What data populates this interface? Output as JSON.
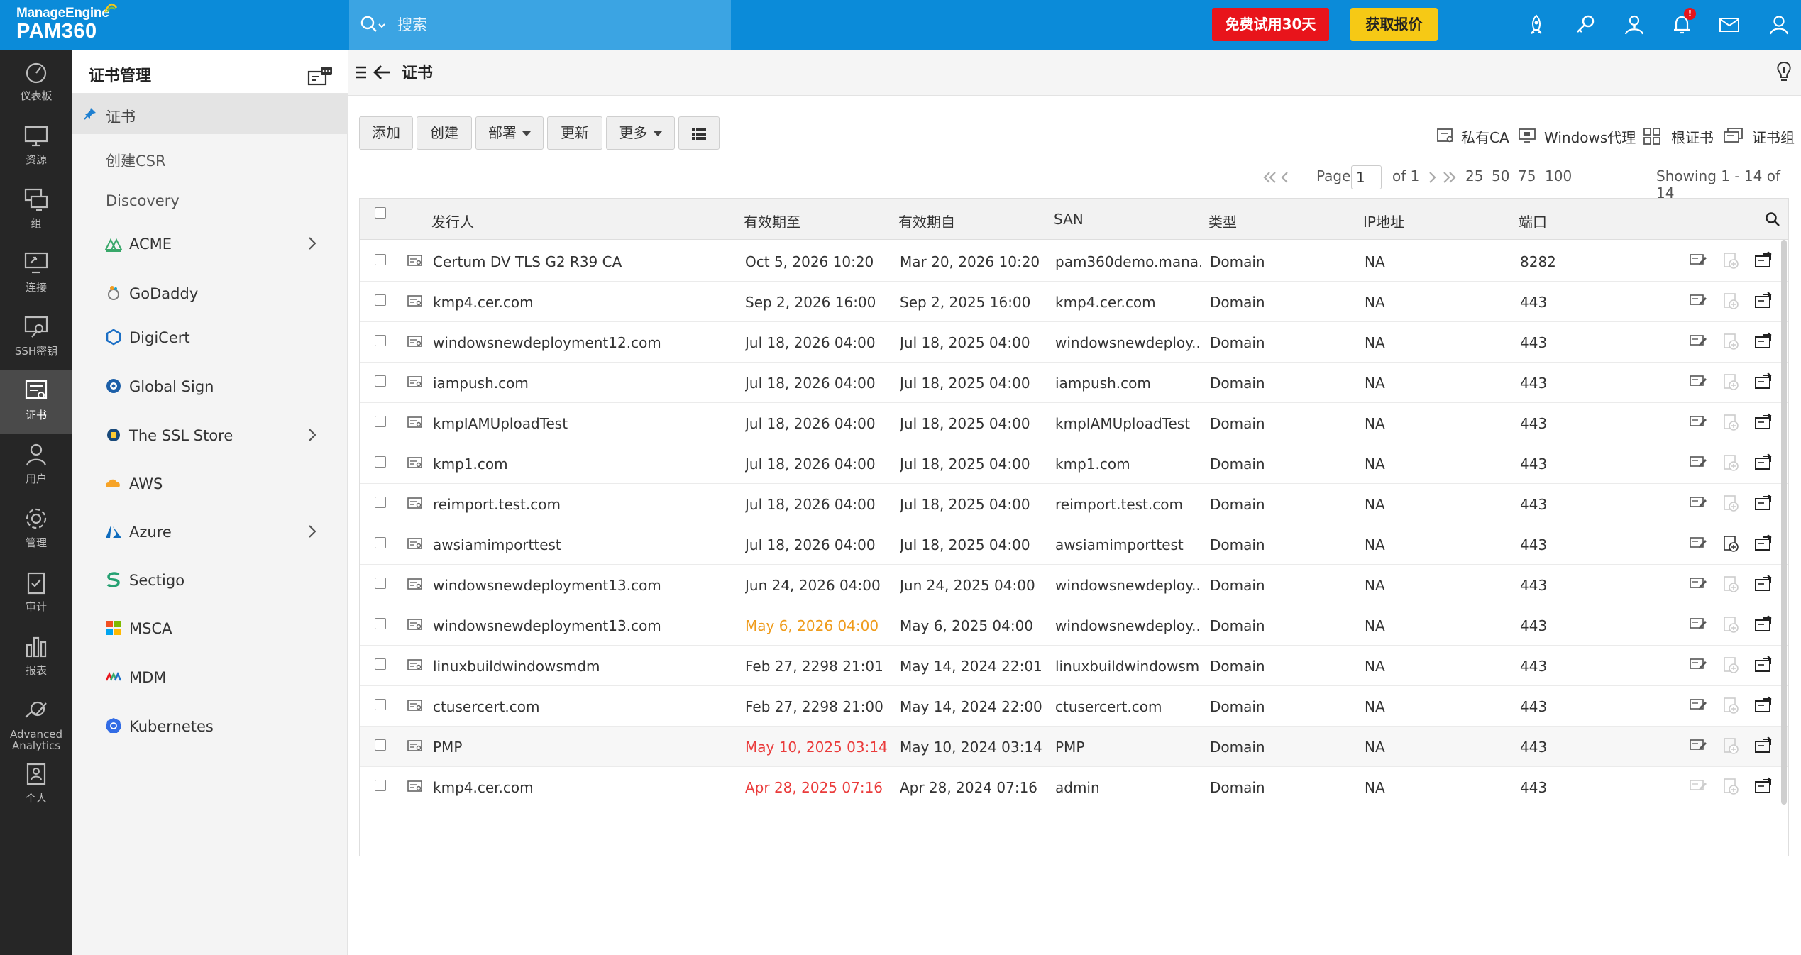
{
  "brand": {
    "vendor": "ManageEngine",
    "product": "PAM360"
  },
  "topbar": {
    "search_placeholder": "搜索",
    "trial_label": "免费试用30天",
    "quote_label": "获取报价",
    "notification_count": "!",
    "icons": [
      "rocket-icon",
      "key-link-icon",
      "user-star-icon",
      "bell-icon",
      "mail-icon",
      "user-icon"
    ]
  },
  "rail": [
    {
      "name": "dashboard",
      "label": "仪表板"
    },
    {
      "name": "resources",
      "label": "资源"
    },
    {
      "name": "groups",
      "label": "组"
    },
    {
      "name": "connections",
      "label": "连接"
    },
    {
      "name": "ssh-keys",
      "label": "SSH密钥"
    },
    {
      "name": "certificates",
      "label": "证书",
      "active": true
    },
    {
      "name": "users",
      "label": "用户"
    },
    {
      "name": "admin",
      "label": "管理"
    },
    {
      "name": "audit",
      "label": "审计"
    },
    {
      "name": "reports",
      "label": "报表"
    },
    {
      "name": "advanced-analytics",
      "label": "Advanced Analytics"
    },
    {
      "name": "personal",
      "label": "个人"
    }
  ],
  "sidenav": {
    "title": "证书管理",
    "items": [
      {
        "label": "证书",
        "active": true
      },
      {
        "label": "创建CSR"
      },
      {
        "label": "Discovery"
      },
      {
        "label": "ACME",
        "has_children": true
      },
      {
        "label": "GoDaddy"
      },
      {
        "label": "DigiCert"
      },
      {
        "label": "Global Sign"
      },
      {
        "label": "The SSL Store",
        "has_children": true
      },
      {
        "label": "AWS"
      },
      {
        "label": "Azure",
        "has_children": true
      },
      {
        "label": "Sectigo"
      },
      {
        "label": "MSCA"
      },
      {
        "label": "MDM"
      },
      {
        "label": "Kubernetes"
      }
    ]
  },
  "page": {
    "title": "证书"
  },
  "toolbar": {
    "add": "添加",
    "create": "创建",
    "deploy": "部署",
    "update": "更新",
    "more": "更多"
  },
  "quick_links": {
    "private_ca": "私有CA",
    "windows_agent": "Windows代理",
    "root_cert": "根证书",
    "cert_group": "证书组"
  },
  "pagination": {
    "page_label": "Page",
    "page": "1",
    "of_label": "of 1",
    "sizes": [
      "25",
      "50",
      "75",
      "100"
    ],
    "showing": "Showing 1 - 14 of 14"
  },
  "table": {
    "columns": [
      "发行人",
      "有效期至",
      "有效期自",
      "SAN",
      "类型",
      "IP地址",
      "端口"
    ],
    "rows": [
      {
        "issuer": "Certum DV TLS G2 R39 CA",
        "valid_to": "Oct 5, 2026 10:20",
        "valid_from": "Mar 20, 2026 10:20",
        "san": "pam360demo.mana...",
        "type": "Domain",
        "ip": "NA",
        "port": "8282",
        "status": ""
      },
      {
        "issuer": "kmp4.cer.com",
        "valid_to": "Sep 2, 2026 16:00",
        "valid_from": "Sep 2, 2025 16:00",
        "san": "kmp4.cer.com",
        "type": "Domain",
        "ip": "NA",
        "port": "443",
        "status": ""
      },
      {
        "issuer": "windowsnewdeployment12.com",
        "valid_to": "Jul 18, 2026 04:00",
        "valid_from": "Jul 18, 2025 04:00",
        "san": "windowsnewdeploy...",
        "type": "Domain",
        "ip": "NA",
        "port": "443",
        "status": ""
      },
      {
        "issuer": "iampush.com",
        "valid_to": "Jul 18, 2026 04:00",
        "valid_from": "Jul 18, 2025 04:00",
        "san": "iampush.com",
        "type": "Domain",
        "ip": "NA",
        "port": "443",
        "status": ""
      },
      {
        "issuer": "kmpIAMUploadTest",
        "valid_to": "Jul 18, 2026 04:00",
        "valid_from": "Jul 18, 2025 04:00",
        "san": "kmpIAMUploadTest",
        "type": "Domain",
        "ip": "NA",
        "port": "443",
        "status": ""
      },
      {
        "issuer": "kmp1.com",
        "valid_to": "Jul 18, 2026 04:00",
        "valid_from": "Jul 18, 2025 04:00",
        "san": "kmp1.com",
        "type": "Domain",
        "ip": "NA",
        "port": "443",
        "status": ""
      },
      {
        "issuer": "reimport.test.com",
        "valid_to": "Jul 18, 2026 04:00",
        "valid_from": "Jul 18, 2025 04:00",
        "san": "reimport.test.com",
        "type": "Domain",
        "ip": "NA",
        "port": "443",
        "status": ""
      },
      {
        "issuer": "awsiamimporttest",
        "valid_to": "Jul 18, 2026 04:00",
        "valid_from": "Jul 18, 2025 04:00",
        "san": "awsiamimporttest",
        "type": "Domain",
        "ip": "NA",
        "port": "443",
        "status": ""
      },
      {
        "issuer": "windowsnewdeployment13.com",
        "valid_to": "Jun 24, 2026 04:00",
        "valid_from": "Jun 24, 2025 04:00",
        "san": "windowsnewdeploy...",
        "type": "Domain",
        "ip": "NA",
        "port": "443",
        "status": ""
      },
      {
        "issuer": "windowsnewdeployment13.com",
        "valid_to": "May 6, 2026 04:00",
        "valid_from": "May 6, 2025 04:00",
        "san": "windowsnewdeploy...",
        "type": "Domain",
        "ip": "NA",
        "port": "443",
        "status": "warn"
      },
      {
        "issuer": "linuxbuildwindowsmdm",
        "valid_to": "Feb 27, 2298 21:01",
        "valid_from": "May 14, 2024 22:01",
        "san": "linuxbuildwindowsm...",
        "type": "Domain",
        "ip": "NA",
        "port": "443",
        "status": ""
      },
      {
        "issuer": "ctusercert.com",
        "valid_to": "Feb 27, 2298 21:00",
        "valid_from": "May 14, 2024 22:00",
        "san": "ctusercert.com",
        "type": "Domain",
        "ip": "NA",
        "port": "443",
        "status": ""
      },
      {
        "issuer": "PMP",
        "valid_to": "May 10, 2025 03:14",
        "valid_from": "May 10, 2024 03:14",
        "san": "PMP",
        "type": "Domain",
        "ip": "NA",
        "port": "443",
        "status": "expired"
      },
      {
        "issuer": "kmp4.cer.com",
        "valid_to": "Apr 28, 2025 07:16",
        "valid_from": "Apr 28, 2024 07:16",
        "san": "admin",
        "type": "Domain",
        "ip": "NA",
        "port": "443",
        "status": "expired"
      }
    ]
  },
  "colors": {
    "topbar": "#0b8bd9",
    "rail": "#262626",
    "trial": "#e8141b",
    "quote": "#f6c915",
    "warn": "#ef9b1a",
    "expired": "#ea3b3b"
  }
}
